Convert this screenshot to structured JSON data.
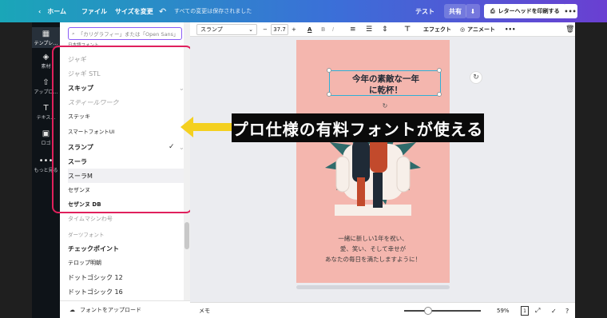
{
  "topbar": {
    "home_label": "ホーム",
    "file_label": "ファイル",
    "resize_label": "サイズを変更",
    "undo_glyph": "↶",
    "saved_status": "すべての変更は保存されました",
    "test_label": "テスト",
    "share_label": "共有",
    "download_glyph": "⬇",
    "print_label": "レターヘッドを印刷する",
    "more_glyph": "•••"
  },
  "sidebar": {
    "items": [
      {
        "label": "テンプレ…",
        "icon": "template-icon"
      },
      {
        "label": "素材",
        "icon": "elements-icon"
      },
      {
        "label": "アップロ…",
        "icon": "upload-icon"
      },
      {
        "label": "テキス…",
        "icon": "text-icon"
      },
      {
        "label": "ロゴ",
        "icon": "logo-icon"
      },
      {
        "label": "もっと見る",
        "icon": "more-icon"
      }
    ]
  },
  "font_panel": {
    "search_placeholder": "「カリグラフィー」または「Open Sans」",
    "sub_label": "日本語フォント",
    "fonts": [
      "ジャギ",
      "ジャギ STL",
      "スキップ",
      "スティールワーク",
      "ステッキ",
      "スマートフォントUI",
      "スランプ",
      "スーラ",
      "スーラM",
      "セザンヌ",
      "セザンヌ DB",
      "タイムマシンわ号",
      "ダーツフォント",
      "チェックポイント",
      "テロップ明朝",
      "ドットゴシック 12",
      "ドットゴシック 16"
    ],
    "selected_font": "スランプ",
    "upload_label": "フォントをアップロード"
  },
  "toolbar": {
    "font_name": "スランプ",
    "font_size": "37.7",
    "minus": "−",
    "plus": "+",
    "color_glyph": "A",
    "bold_glyph": "B",
    "italic_glyph": "I",
    "effects_label": "エフェクト",
    "animate_label": "アニメート",
    "more_glyph": "•••"
  },
  "canvas": {
    "title_line1": "今年の素敵な一年",
    "title_line2": "に乾杯！",
    "body_lines": [
      "一緒に新しい1年を祝い、",
      "愛、笑い、そして幸せが",
      "あなたの毎日を満たしますように！"
    ],
    "colors": {
      "page_background": "#f4b6ae",
      "selection": "#2fb0d6"
    }
  },
  "annotation": {
    "text": "プロ仕様の有料フォントが使える",
    "colors": {
      "arrow": "#f4d020",
      "box": "#e0205c"
    }
  },
  "bottombar": {
    "memo_label": "メモ",
    "zoom_value": "59%",
    "page_count": "1"
  }
}
